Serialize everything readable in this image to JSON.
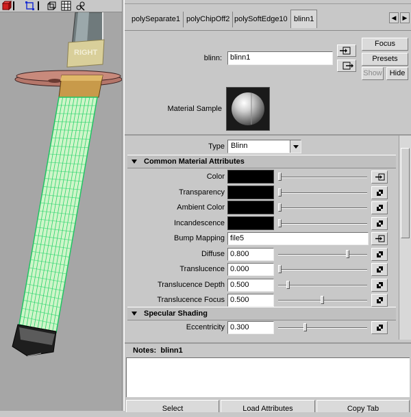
{
  "viewport": {
    "cube_label": "RIGHT",
    "toolbar_icons": [
      "red-cube-icon",
      "select-box-icon",
      "wire-cube-icon",
      "grid-icon",
      "render-icon"
    ]
  },
  "tabs": [
    {
      "label": "polySeparate1",
      "active": false
    },
    {
      "label": "polyChipOff2",
      "active": false
    },
    {
      "label": "polySoftEdge10",
      "active": false
    },
    {
      "label": "blinn1",
      "active": true
    }
  ],
  "tab_scroll": {
    "left": "◀",
    "right": "▶"
  },
  "header": {
    "node_label": "blinn:",
    "node_name": "blinn1",
    "focus_label": "Focus",
    "presets_label": "Presets",
    "show_label": "Show",
    "hide_label": "Hide",
    "material_sample_label": "Material Sample"
  },
  "type": {
    "label": "Type",
    "value": "Blinn"
  },
  "sections": {
    "common": "Common Material Attributes",
    "specular": "Specular Shading"
  },
  "common_attributes": [
    {
      "label": "Color",
      "kind": "color",
      "slider": 0.0,
      "map_icon": "map-input-icon"
    },
    {
      "label": "Transparency",
      "kind": "color",
      "slider": 0.0,
      "map_icon": "checker-icon"
    },
    {
      "label": "Ambient Color",
      "kind": "color",
      "slider": 0.0,
      "map_icon": "checker-icon"
    },
    {
      "label": "Incandescence",
      "kind": "color",
      "slider": 0.0,
      "map_icon": "checker-icon"
    },
    {
      "label": "Bump Mapping",
      "kind": "text",
      "value": "file5",
      "map_icon": "map-input-icon"
    },
    {
      "label": "Diffuse",
      "kind": "number",
      "value": "0.800",
      "slider": 0.8,
      "map_icon": "checker-icon"
    },
    {
      "label": "Translucence",
      "kind": "number",
      "value": "0.000",
      "slider": 0.0,
      "map_icon": "checker-icon"
    },
    {
      "label": "Translucence Depth",
      "kind": "number",
      "value": "0.500",
      "slider": 0.1,
      "map_icon": "checker-icon"
    },
    {
      "label": "Translucence Focus",
      "kind": "number",
      "value": "0.500",
      "slider": 0.5,
      "map_icon": "checker-icon"
    }
  ],
  "specular_attributes": [
    {
      "label": "Eccentricity",
      "kind": "number",
      "value": "0.300",
      "slider": 0.3,
      "map_icon": "checker-icon"
    }
  ],
  "notes": {
    "label": "Notes:",
    "node": "blinn1"
  },
  "bottom_buttons": [
    "Select",
    "Load Attributes",
    "Copy Tab"
  ],
  "colors": {
    "panel": "#c8c8c8",
    "viewport_bg": "#a6a6a6",
    "grip_wire": "#26d66b",
    "grip_fill": "#cdf3c8",
    "guard": "#c07a6c"
  }
}
